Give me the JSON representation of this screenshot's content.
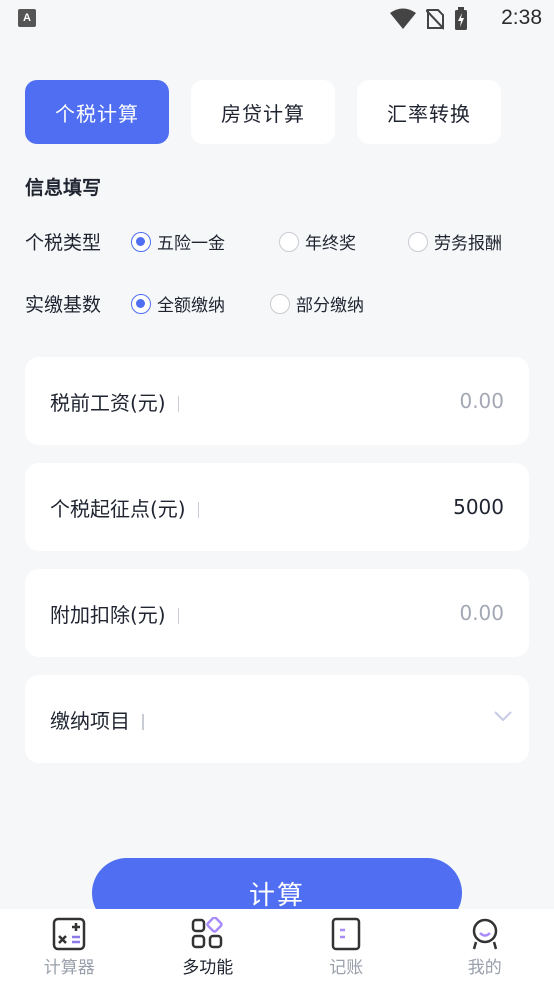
{
  "status_bar": {
    "time": "2:38",
    "app_indicator": "A"
  },
  "tabs": [
    {
      "label": "个税计算",
      "active": true
    },
    {
      "label": "房贷计算",
      "active": false
    },
    {
      "label": "汇率转换",
      "active": false
    }
  ],
  "section_title": "信息填写",
  "tax_type": {
    "label": "个税类型",
    "options": [
      {
        "label": "五险一金",
        "checked": true
      },
      {
        "label": "年终奖",
        "checked": false
      },
      {
        "label": "劳务报酬",
        "checked": false
      }
    ]
  },
  "contribution_base": {
    "label": "实缴基数",
    "options": [
      {
        "label": "全额缴纳",
        "checked": true
      },
      {
        "label": "部分缴纳",
        "checked": false
      }
    ]
  },
  "fields": {
    "pretax_salary": {
      "label": "税前工资(元)",
      "placeholder": "0.00"
    },
    "threshold": {
      "label": "个税起征点(元)",
      "value": "5000"
    },
    "additional_deduction": {
      "label": "附加扣除(元)",
      "placeholder": "0.00"
    },
    "payment_items": {
      "label": "缴纳项目"
    }
  },
  "calc_button": {
    "label": "计算"
  },
  "bottom_nav": [
    {
      "label": "计算器",
      "icon": "calculator-icon",
      "active": false
    },
    {
      "label": "多功能",
      "icon": "grid-apps-icon",
      "active": true
    },
    {
      "label": "记账",
      "icon": "notebook-icon",
      "active": false
    },
    {
      "label": "我的",
      "icon": "profile-icon",
      "active": false
    }
  ],
  "colors": {
    "accent": "#4f6ef2",
    "background": "#f6f7f9",
    "text": "#1f2430",
    "muted": "#9aa0ab"
  }
}
